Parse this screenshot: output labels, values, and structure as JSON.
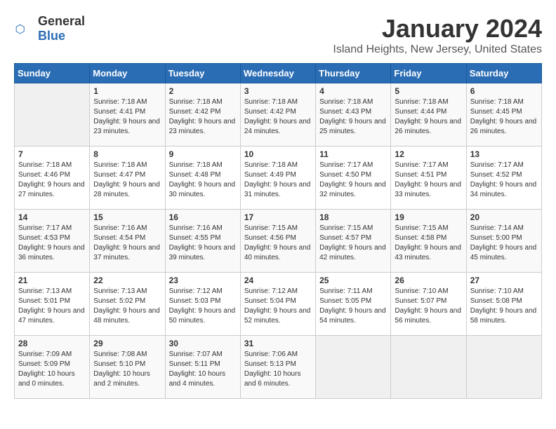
{
  "header": {
    "logo_general": "General",
    "logo_blue": "Blue",
    "title": "January 2024",
    "subtitle": "Island Heights, New Jersey, United States"
  },
  "weekdays": [
    "Sunday",
    "Monday",
    "Tuesday",
    "Wednesday",
    "Thursday",
    "Friday",
    "Saturday"
  ],
  "weeks": [
    [
      {
        "day": "",
        "empty": true
      },
      {
        "day": "1",
        "sunrise": "7:18 AM",
        "sunset": "4:41 PM",
        "daylight": "9 hours and 23 minutes."
      },
      {
        "day": "2",
        "sunrise": "7:18 AM",
        "sunset": "4:42 PM",
        "daylight": "9 hours and 23 minutes."
      },
      {
        "day": "3",
        "sunrise": "7:18 AM",
        "sunset": "4:42 PM",
        "daylight": "9 hours and 24 minutes."
      },
      {
        "day": "4",
        "sunrise": "7:18 AM",
        "sunset": "4:43 PM",
        "daylight": "9 hours and 25 minutes."
      },
      {
        "day": "5",
        "sunrise": "7:18 AM",
        "sunset": "4:44 PM",
        "daylight": "9 hours and 26 minutes."
      },
      {
        "day": "6",
        "sunrise": "7:18 AM",
        "sunset": "4:45 PM",
        "daylight": "9 hours and 26 minutes."
      }
    ],
    [
      {
        "day": "7",
        "sunrise": "7:18 AM",
        "sunset": "4:46 PM",
        "daylight": "9 hours and 27 minutes."
      },
      {
        "day": "8",
        "sunrise": "7:18 AM",
        "sunset": "4:47 PM",
        "daylight": "9 hours and 28 minutes."
      },
      {
        "day": "9",
        "sunrise": "7:18 AM",
        "sunset": "4:48 PM",
        "daylight": "9 hours and 30 minutes."
      },
      {
        "day": "10",
        "sunrise": "7:18 AM",
        "sunset": "4:49 PM",
        "daylight": "9 hours and 31 minutes."
      },
      {
        "day": "11",
        "sunrise": "7:17 AM",
        "sunset": "4:50 PM",
        "daylight": "9 hours and 32 minutes."
      },
      {
        "day": "12",
        "sunrise": "7:17 AM",
        "sunset": "4:51 PM",
        "daylight": "9 hours and 33 minutes."
      },
      {
        "day": "13",
        "sunrise": "7:17 AM",
        "sunset": "4:52 PM",
        "daylight": "9 hours and 34 minutes."
      }
    ],
    [
      {
        "day": "14",
        "sunrise": "7:17 AM",
        "sunset": "4:53 PM",
        "daylight": "9 hours and 36 minutes."
      },
      {
        "day": "15",
        "sunrise": "7:16 AM",
        "sunset": "4:54 PM",
        "daylight": "9 hours and 37 minutes."
      },
      {
        "day": "16",
        "sunrise": "7:16 AM",
        "sunset": "4:55 PM",
        "daylight": "9 hours and 39 minutes."
      },
      {
        "day": "17",
        "sunrise": "7:15 AM",
        "sunset": "4:56 PM",
        "daylight": "9 hours and 40 minutes."
      },
      {
        "day": "18",
        "sunrise": "7:15 AM",
        "sunset": "4:57 PM",
        "daylight": "9 hours and 42 minutes."
      },
      {
        "day": "19",
        "sunrise": "7:15 AM",
        "sunset": "4:58 PM",
        "daylight": "9 hours and 43 minutes."
      },
      {
        "day": "20",
        "sunrise": "7:14 AM",
        "sunset": "5:00 PM",
        "daylight": "9 hours and 45 minutes."
      }
    ],
    [
      {
        "day": "21",
        "sunrise": "7:13 AM",
        "sunset": "5:01 PM",
        "daylight": "9 hours and 47 minutes."
      },
      {
        "day": "22",
        "sunrise": "7:13 AM",
        "sunset": "5:02 PM",
        "daylight": "9 hours and 48 minutes."
      },
      {
        "day": "23",
        "sunrise": "7:12 AM",
        "sunset": "5:03 PM",
        "daylight": "9 hours and 50 minutes."
      },
      {
        "day": "24",
        "sunrise": "7:12 AM",
        "sunset": "5:04 PM",
        "daylight": "9 hours and 52 minutes."
      },
      {
        "day": "25",
        "sunrise": "7:11 AM",
        "sunset": "5:05 PM",
        "daylight": "9 hours and 54 minutes."
      },
      {
        "day": "26",
        "sunrise": "7:10 AM",
        "sunset": "5:07 PM",
        "daylight": "9 hours and 56 minutes."
      },
      {
        "day": "27",
        "sunrise": "7:10 AM",
        "sunset": "5:08 PM",
        "daylight": "9 hours and 58 minutes."
      }
    ],
    [
      {
        "day": "28",
        "sunrise": "7:09 AM",
        "sunset": "5:09 PM",
        "daylight": "10 hours and 0 minutes."
      },
      {
        "day": "29",
        "sunrise": "7:08 AM",
        "sunset": "5:10 PM",
        "daylight": "10 hours and 2 minutes."
      },
      {
        "day": "30",
        "sunrise": "7:07 AM",
        "sunset": "5:11 PM",
        "daylight": "10 hours and 4 minutes."
      },
      {
        "day": "31",
        "sunrise": "7:06 AM",
        "sunset": "5:13 PM",
        "daylight": "10 hours and 6 minutes."
      },
      {
        "day": "",
        "empty": true
      },
      {
        "day": "",
        "empty": true
      },
      {
        "day": "",
        "empty": true
      }
    ]
  ]
}
